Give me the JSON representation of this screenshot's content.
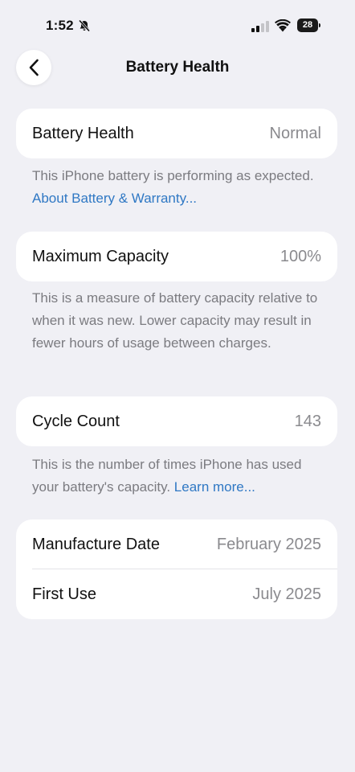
{
  "status_bar": {
    "time": "1:52",
    "battery_level": "28",
    "icons": [
      "bell-slash-icon",
      "cellular-signal-icon",
      "wifi-icon",
      "battery-icon"
    ]
  },
  "header": {
    "back_icon": "chevron-left-icon",
    "title": "Battery Health"
  },
  "battery_health": {
    "label": "Battery Health",
    "value": "Normal",
    "footnote_text": "This iPhone battery is performing as expected.",
    "footnote_link": "About Battery & Warranty..."
  },
  "maximum_capacity": {
    "label": "Maximum Capacity",
    "value": "100%",
    "footnote_text": "This is a measure of battery capacity relative to when it was new. Lower capacity may result in fewer hours of usage between charges."
  },
  "cycle_count": {
    "label": "Cycle Count",
    "value": "143",
    "footnote_text": "This is the number of times iPhone has used your battery's capacity.",
    "footnote_link": "Learn more..."
  },
  "dates": {
    "manufacture_label": "Manufacture Date",
    "manufacture_value": "February 2025",
    "first_use_label": "First Use",
    "first_use_value": "July 2025"
  },
  "colors": {
    "background": "#f0f0f5",
    "card": "#ffffff",
    "link": "#2f78c4",
    "secondary_text": "#8a8a8e"
  }
}
